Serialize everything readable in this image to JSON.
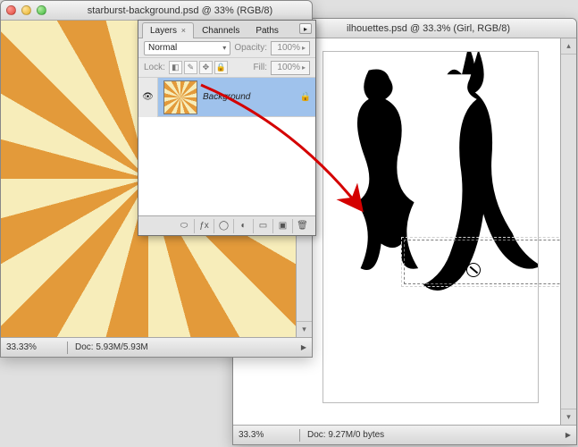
{
  "doc_a": {
    "title": "starburst-background.psd @ 33% (RGB/8)",
    "zoom": "33.33%",
    "doc_info": "Doc: 5.93M/5.93M"
  },
  "doc_b": {
    "title": "ilhouettes.psd @ 33.3% (Girl, RGB/8)",
    "zoom": "33.3%",
    "doc_info": "Doc: 9.27M/0 bytes"
  },
  "panel": {
    "tabs": {
      "layers": "Layers",
      "channels": "Channels",
      "paths": "Paths"
    },
    "blend_label": "",
    "blend_value": "Normal",
    "opacity_label": "Opacity:",
    "opacity_value": "100%",
    "lock_label": "Lock:",
    "fill_label": "Fill:",
    "fill_value": "100%",
    "layer": {
      "name": "Background"
    }
  }
}
